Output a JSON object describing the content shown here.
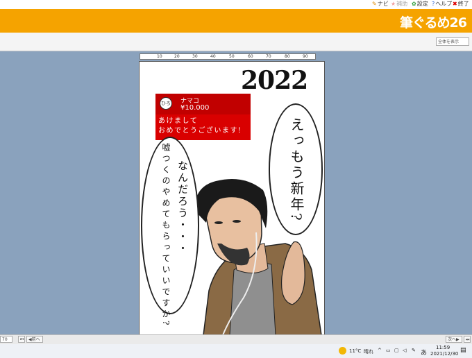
{
  "top_menu": {
    "items": [
      {
        "label": "ナビ",
        "icon": "pencil-icon"
      },
      {
        "label": "補助",
        "icon": "star-icon"
      },
      {
        "label": "設定",
        "icon": "gear-icon"
      },
      {
        "label": "ヘルプ",
        "icon": "question-icon"
      },
      {
        "label": "終了",
        "icon": "close-icon"
      }
    ]
  },
  "banner": {
    "brand": "筆ぐるめ26",
    "color": "#f5a300"
  },
  "toolbar": {
    "view_select": "全体を表示"
  },
  "ruler": {
    "ticks": [
      "10",
      "20",
      "30",
      "40",
      "50",
      "60",
      "70",
      "80",
      "90"
    ]
  },
  "card": {
    "year": "2022",
    "chat": {
      "avatar_text": "ひろ",
      "name": "ナマコ",
      "amount": "¥10.000",
      "message_line1": "あけまして",
      "message_line2": "おめでとうございます!"
    },
    "bubble_right": "えっもう新年?",
    "bubble_left_main": "なんだろう・・・",
    "bubble_left_sub": "嘘つくのやめてもらっていいですか?"
  },
  "navbar": {
    "zoom": "70",
    "prev": "前へ",
    "next": "次へ"
  },
  "taskbar": {
    "temperature": "11°C",
    "weather": "晴れ",
    "ime": "あ",
    "time": "11:59",
    "date": "2021/12/30"
  }
}
